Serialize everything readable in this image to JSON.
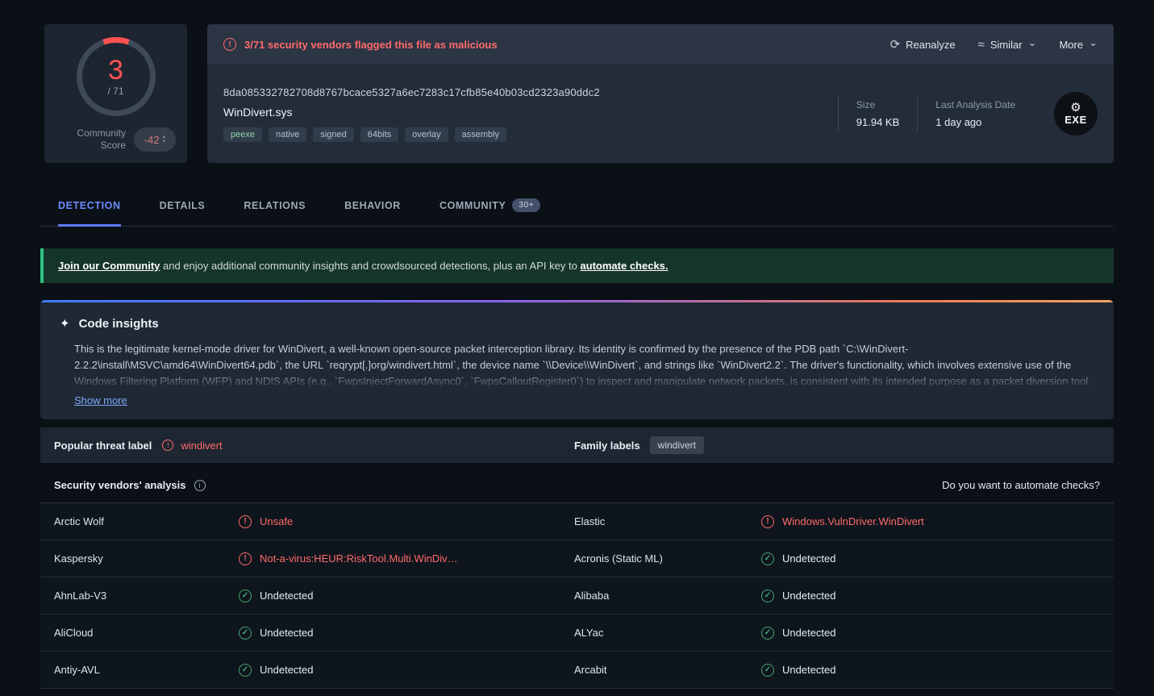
{
  "icons": {
    "warning": "!",
    "reanalyze": "⟳",
    "similar": "≈",
    "chevron_down": "⌄",
    "sparkle": "✦",
    "info": "i",
    "error": "!",
    "check": "✓",
    "gear": "⚙",
    "step_up": "▴",
    "step_down": "▾"
  },
  "score": {
    "detections": "3",
    "total": "/ 71",
    "community_label_line1": "Community",
    "community_label_line2": "Score",
    "community_value": "-42"
  },
  "header": {
    "warning_text": "3/71 security vendors flagged this file as malicious",
    "actions": {
      "reanalyze": "Reanalyze",
      "similar": "Similar",
      "more": "More"
    },
    "hash": "8da085332782708d8767bcace5327a6ec7283c17cfb85e40b03cd2323a90ddc2",
    "filename": "WinDivert.sys",
    "tags": [
      "peexe",
      "native",
      "signed",
      "64bits",
      "overlay",
      "assembly"
    ],
    "size_label": "Size",
    "size_value": "91.94 KB",
    "date_label": "Last Analysis Date",
    "date_value": "1 day ago",
    "file_type_badge": "EXE"
  },
  "tabs": {
    "detection": "DETECTION",
    "details": "DETAILS",
    "relations": "RELATIONS",
    "behavior": "BEHAVIOR",
    "community": "COMMUNITY",
    "community_badge": "30+"
  },
  "community_banner": {
    "link1": "Join our Community",
    "text1": " and enjoy additional community insights and crowdsourced detections, plus an API key to ",
    "link2": "automate checks."
  },
  "code_insights": {
    "title": "Code insights",
    "body": "This is the legitimate kernel-mode driver for WinDivert, a well-known open-source packet interception library. Its identity is confirmed by the presence of the PDB path `C:\\WinDivert-2.2.2\\install\\MSVC\\amd64\\WinDivert64.pdb`, the URL `reqrypt[.]org/windivert.html`, the device name `\\\\Device\\\\WinDivert`, and strings like `WinDivert2.2`. The driver's functionality, which involves extensive use of the Windows Filtering Platform (WFP) and NDIS APIs (e.g., `FwpsInjectForwardAsync0`, `FwpsCalloutRegister0`) to inspect and manipulate network packets, is consistent with its intended purpose as a packet diversion tool.",
    "show_more": "Show more"
  },
  "threat": {
    "label": "Popular threat label",
    "value": "windivert",
    "family_label": "Family labels",
    "family_value": "windivert"
  },
  "analysis": {
    "title": "Security vendors' analysis",
    "automate": "Do you want to automate checks?",
    "rows": [
      {
        "vendor_a": "Arctic Wolf",
        "status_a": "Unsafe",
        "vendor_b": "Elastic",
        "status_b": "Windows.VulnDriver.WinDivert"
      },
      {
        "vendor_a": "Kaspersky",
        "status_a": "Not-a-virus:HEUR:RiskTool.Multi.WinDiv…",
        "vendor_b": "Acronis (Static ML)",
        "status_b": "Undetected"
      },
      {
        "vendor_a": "AhnLab-V3",
        "status_a": "Undetected",
        "vendor_b": "Alibaba",
        "status_b": "Undetected"
      },
      {
        "vendor_a": "AliCloud",
        "status_a": "Undetected",
        "vendor_b": "ALYac",
        "status_b": "Undetected"
      },
      {
        "vendor_a": "Antiy-AVL",
        "status_a": "Undetected",
        "vendor_b": "Arcabit",
        "status_b": "Undetected"
      }
    ]
  }
}
